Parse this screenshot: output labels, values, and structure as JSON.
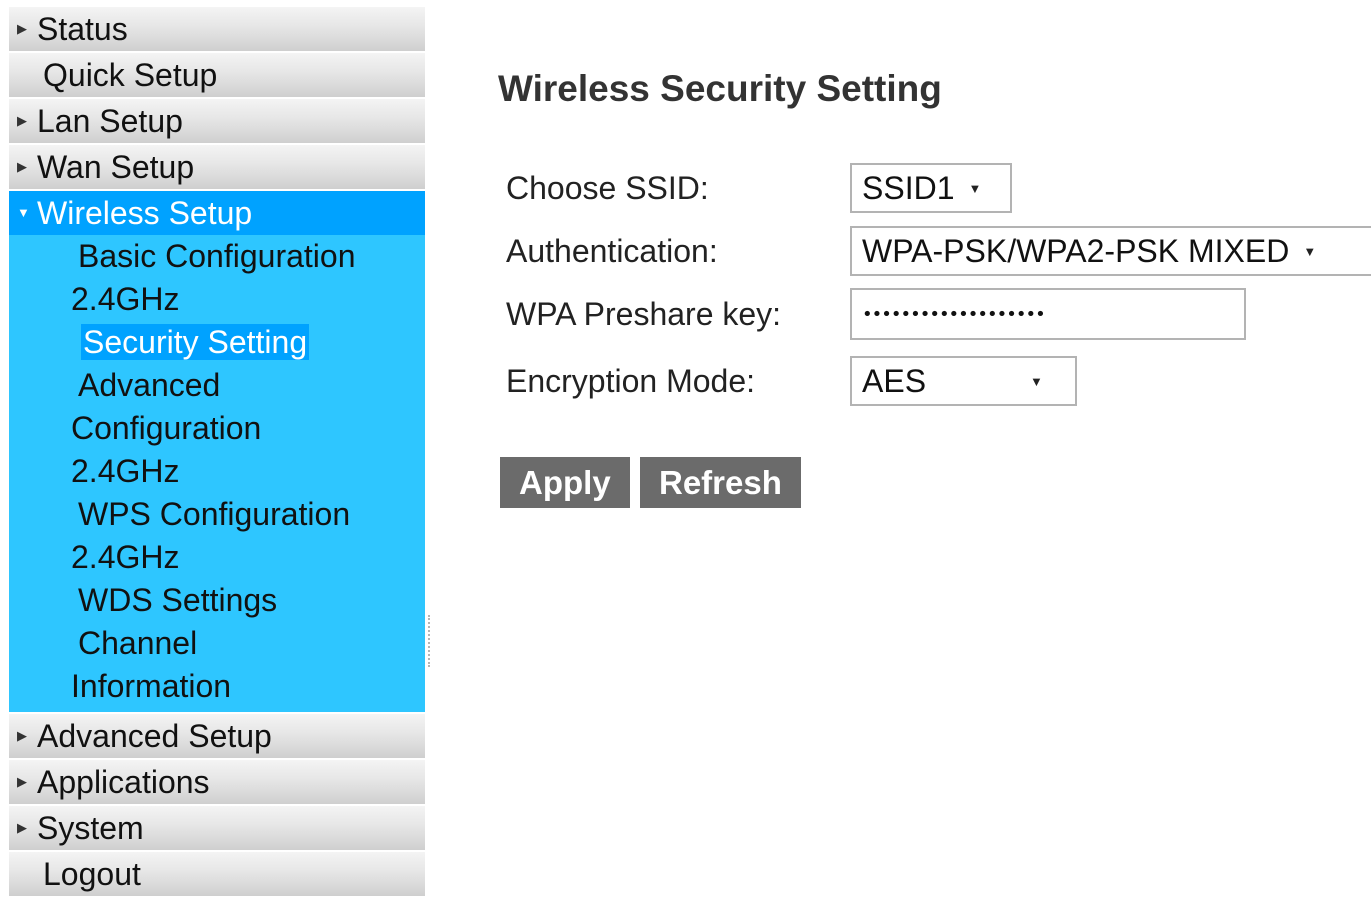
{
  "sidebar": {
    "items_top": [
      {
        "label": "Status",
        "arrow": true
      },
      {
        "label": "Quick Setup",
        "arrow": false
      },
      {
        "label": "Lan Setup",
        "arrow": true
      },
      {
        "label": "Wan Setup",
        "arrow": true
      }
    ],
    "active": {
      "label": "Wireless Setup"
    },
    "submenu": {
      "basic_config": {
        "line1": "Basic Configuration",
        "line2": "2.4GHz"
      },
      "security": {
        "line1": "Security Setting"
      },
      "advanced_config": {
        "line1": "Advanced",
        "line2": "Configuration",
        "line3": "2.4GHz"
      },
      "wps_config": {
        "line1": "WPS Configuration",
        "line2": "2.4GHz"
      },
      "wds": {
        "line1": "WDS Settings"
      },
      "channel_info": {
        "line1": "Channel",
        "line2": "Information"
      }
    },
    "items_bottom": [
      {
        "label": "Advanced Setup",
        "arrow": true
      },
      {
        "label": "Applications",
        "arrow": true
      },
      {
        "label": "System",
        "arrow": true
      },
      {
        "label": "Logout",
        "arrow": false
      }
    ]
  },
  "main": {
    "title": "Wireless Security Setting",
    "form": {
      "ssid_label": "Choose SSID:",
      "ssid_value": "SSID1",
      "auth_label": "Authentication:",
      "auth_value": "WPA-PSK/WPA2-PSK MIXED",
      "key_label": "WPA Preshare key:",
      "key_value": "•••••••••••••••••••",
      "enc_label": "Encryption Mode:",
      "enc_value": "AES"
    },
    "buttons": {
      "apply": "Apply",
      "refresh": "Refresh"
    }
  },
  "icons": {
    "collapsed": "triangle-right",
    "expanded": "triangle-down",
    "select_caret": "triangle-down-small"
  },
  "colors": {
    "active_bg": "#00a2ff",
    "submenu_bg": "#2ec6ff",
    "button_bg": "#6b6b6b"
  }
}
